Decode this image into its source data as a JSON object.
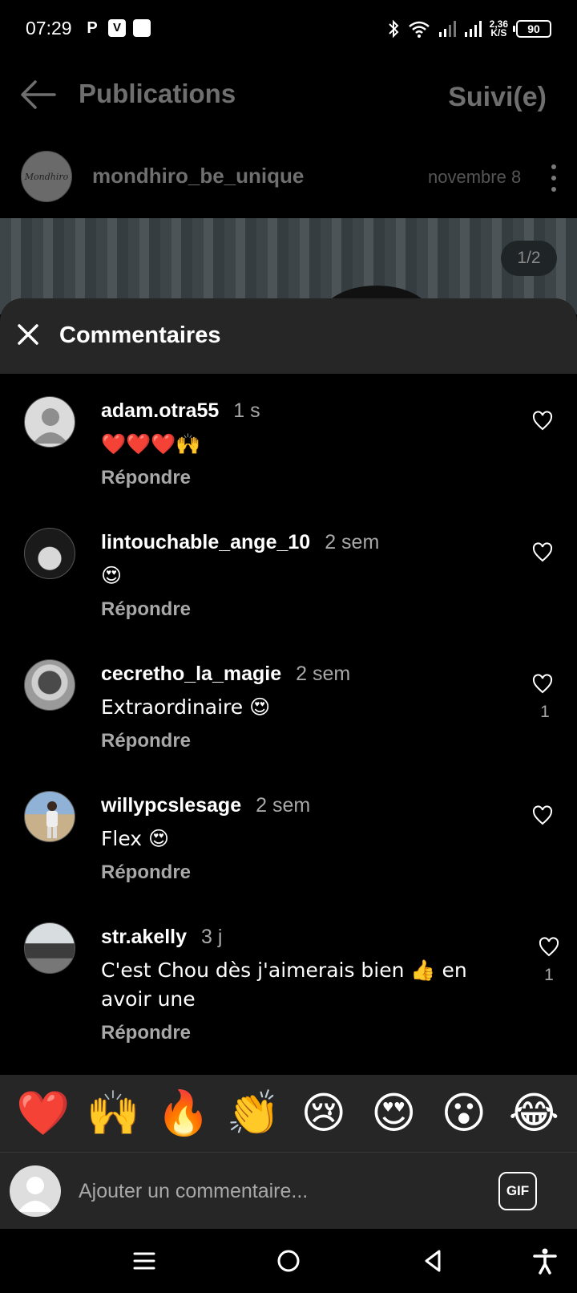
{
  "status_bar": {
    "time": "07:29",
    "app_icons": [
      "P",
      "V",
      ""
    ],
    "net_speed_value": "2,36",
    "net_speed_unit": "K/S",
    "battery": "90"
  },
  "header": {
    "title": "Publications",
    "follow_label": "Suivi(e)"
  },
  "post": {
    "username": "mondhiro_be_unique",
    "date": "novembre 8",
    "image_counter": "1/2",
    "avatar_text": "Mondhiro"
  },
  "comments_sheet": {
    "title": "Commentaires",
    "reply_label": "Répondre",
    "comments": [
      {
        "username": "adam.otra55",
        "time": "1 s",
        "text": "❤️❤️❤️🙌",
        "likes": "",
        "avatar": "default"
      },
      {
        "username": "lintouchable_ange_10",
        "time": "2 sem",
        "text": "😍",
        "likes": "",
        "avatar": "dark"
      },
      {
        "username": "cecretho_la_magie",
        "time": "2 sem",
        "text": "Extraordinaire 😍",
        "likes": "1",
        "avatar": "photo-gray"
      },
      {
        "username": "willypcslesage",
        "time": "2 sem",
        "text": "Flex 😍",
        "likes": "",
        "avatar": "photo-beach"
      },
      {
        "username": "str.akelly",
        "time": "3 j",
        "text": "C'est Chou dès j'aimerais bien 👍 en avoir une",
        "likes": "1",
        "avatar": "photo-street"
      }
    ]
  },
  "emoji_bar": [
    "❤️",
    "🙌",
    "🔥",
    "👏",
    "😢",
    "😍",
    "😮",
    "😂"
  ],
  "input": {
    "placeholder": "Ajouter un commentaire...",
    "gif_label": "GIF"
  },
  "colors": {
    "background": "#000000",
    "sheet_header": "#262626",
    "secondary_text": "#a8a8a8"
  }
}
